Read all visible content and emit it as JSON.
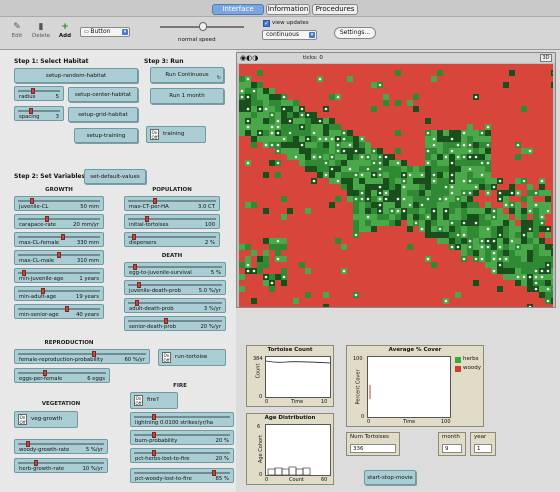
{
  "tabs": [
    {
      "label": "Interface",
      "active": true
    },
    {
      "label": "Information"
    },
    {
      "label": "Procedures"
    }
  ],
  "toolbar": {
    "edit": "Edit",
    "delete": "Delete",
    "add": "Add",
    "widget_type": "Button",
    "speed_label": "normal speed",
    "view_updates": "view updates",
    "update_mode": "continuous",
    "settings": "Settings..."
  },
  "steps": {
    "step1": "Step 1: Select Habitat",
    "step3": "Step 3: Run",
    "step2": "Step 2: Set Variables"
  },
  "buttons": {
    "setup_random": "setup-random-habitat",
    "setup_center": "setup-center-habitat",
    "setup_grid": "setup-grid-habitat",
    "setup_training": "setup-training",
    "run_continuous": "Run Continuous",
    "run_1_month": "Run 1 month",
    "set_default": "set-default-values",
    "run_tortoise": "run-tortoise",
    "fire": "fire?",
    "veg_growth": "veg-growth",
    "start_stop_movie": "start-stop-movie"
  },
  "switches": {
    "on": "On",
    "off": "Off",
    "training": "training"
  },
  "sections": {
    "growth": "GROWTH",
    "population": "POPULATION",
    "death": "DEATH",
    "reproduction": "REPRODUCTION",
    "fire": "FIRE",
    "vegetation": "VEGETATION"
  },
  "sliders": {
    "radius": {
      "name": "radius",
      "value": "5",
      "level": 0.35
    },
    "spacing": {
      "name": "spacing",
      "value": "3",
      "level": 0.3
    },
    "juvenile_cl": {
      "name": "juvenile-CL",
      "value": "50 mm",
      "level": 0.15
    },
    "carapace_rate": {
      "name": "carapace-rate",
      "value": "20 mm/yr",
      "level": 0.35
    },
    "max_cl_female": {
      "name": "max-CL-female",
      "value": "330 mm",
      "level": 0.55
    },
    "max_cl_male": {
      "name": "max-CL-male",
      "value": "310 mm",
      "level": 0.5
    },
    "min_juvenile_age": {
      "name": "min-juvenile-age",
      "value": "1 years",
      "level": 0.05
    },
    "min_adult_age": {
      "name": "min-adult-age",
      "value": "19 years",
      "level": 0.3
    },
    "min_senior_age": {
      "name": "min-senior-age",
      "value": "40 years",
      "level": 0.6
    },
    "max_ct_per_ha": {
      "name": "max-CT-per-HA",
      "value": "3.0 CT",
      "level": 0.3
    },
    "initial_tortoises": {
      "name": "initial-tortoises",
      "value": "100",
      "level": 0.2
    },
    "dispersers": {
      "name": "dispersers",
      "value": "2 %",
      "level": 0.05
    },
    "egg_to_juvenile": {
      "name": "egg-to-juvenile-survival",
      "value": "5 %",
      "level": 0.05
    },
    "juvenile_death": {
      "name": "juvenile-death-prob",
      "value": "5.0 %/yr",
      "level": 0.1
    },
    "adult_death": {
      "name": "adult-death-prob",
      "value": "3 %/yr",
      "level": 0.08
    },
    "senior_death": {
      "name": "senior-death-prob",
      "value": "20 %/yr",
      "level": 0.4
    },
    "female_repro": {
      "name": "female-reproduction-probability",
      "value": "60 %/yr",
      "level": 0.6
    },
    "eggs_per_female": {
      "name": "eggs-per-female",
      "value": "6 eggs",
      "level": 0.3
    },
    "lightning": {
      "name": "lightning 0.0100 strikes/yr/ha",
      "value": "",
      "level": 0.2
    },
    "burn_probability": {
      "name": "burn-probability",
      "value": "20 %",
      "level": 0.2
    },
    "pct_herbs_lost": {
      "name": "pct-herbs-lost-to-fire",
      "value": "20 %",
      "level": 0.2
    },
    "pct_woody_lost": {
      "name": "pct-woody-lost-to-fire",
      "value": "85 %",
      "level": 0.85
    },
    "woody_growth": {
      "name": "woody-growth-rate",
      "value": "5 %/yr",
      "level": 0.1
    },
    "herb_growth": {
      "name": "herb-growth-rate",
      "value": "10 %/yr",
      "level": 0.2
    }
  },
  "view": {
    "ticks_label": "ticks: 0",
    "zoom": "3D"
  },
  "plots": {
    "tortoise_count": {
      "title": "Tortoise Count",
      "ylabel": "Count",
      "xlabel": "Time",
      "ymax": "384",
      "ymin": "0",
      "xmin": "0",
      "xmax": "10"
    },
    "age_distribution": {
      "title": "Age Distribution",
      "ylabel": "Age Cohort",
      "xlabel": "Count",
      "ymax": "6",
      "ymin": "0",
      "xmin": "0",
      "xmax": "60"
    },
    "average_cover": {
      "title": "Average % Cover",
      "ylabel": "Percent Cover",
      "xlabel": "Time",
      "ymax": "100",
      "ymin": "0",
      "xmin": "0",
      "xmax": "100",
      "legend": [
        {
          "name": "herbs",
          "color": "#3aa83a"
        },
        {
          "name": "woody",
          "color": "#d63a32"
        }
      ]
    }
  },
  "monitors": {
    "num_tortoises": {
      "label": "Num Tortoises",
      "value": "336"
    },
    "month": {
      "label": "month",
      "value": "9"
    },
    "year": {
      "label": "year",
      "value": "1"
    }
  },
  "colors": {
    "accent": "#a9cdd3",
    "world_red": "#d8453a",
    "world_green": "#3a9a3a"
  }
}
